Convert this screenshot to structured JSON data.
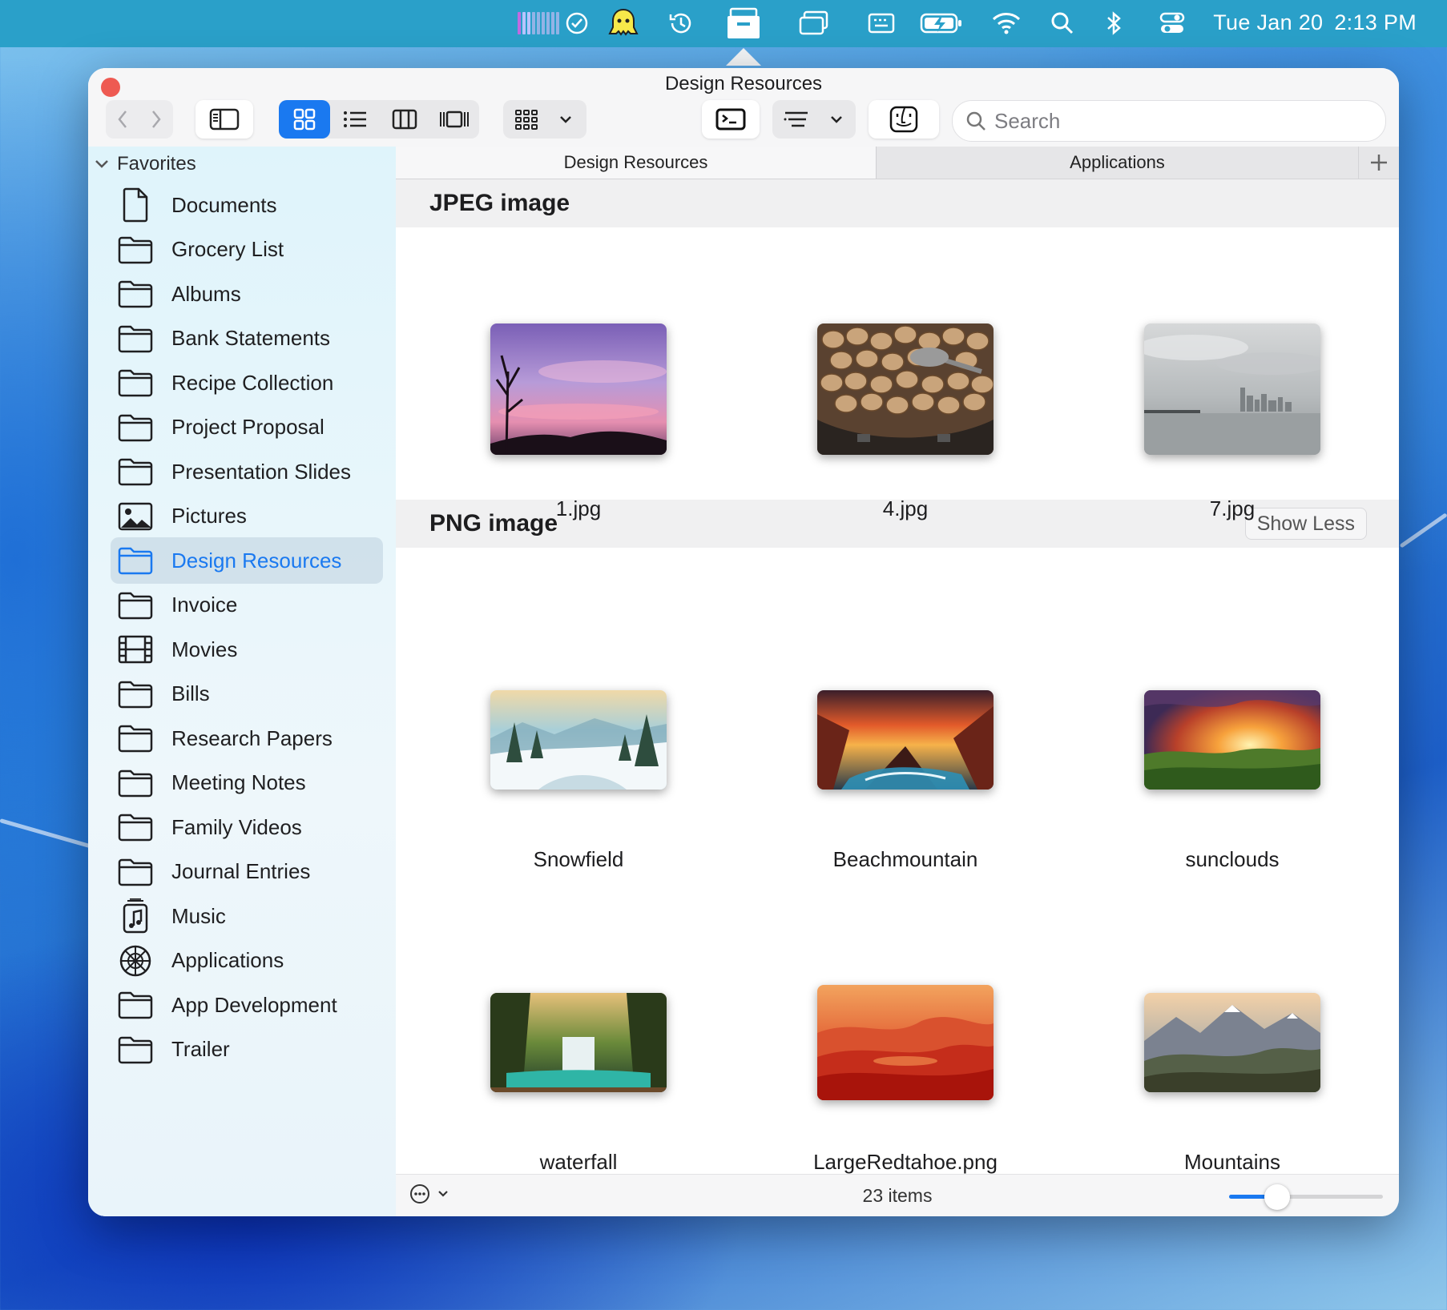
{
  "menubar": {
    "date": "Tue Jan 20",
    "time": "2:13 PM",
    "icons": [
      "activity-bars-icon",
      "check-circle-icon",
      "ghost-app-icon",
      "time-machine-icon",
      "finder-drawer-icon",
      "window-stack-icon",
      "keyboard-icon",
      "battery-charging-icon",
      "wifi-icon",
      "spotlight-search-icon",
      "bluetooth-icon",
      "control-center-icon"
    ]
  },
  "window": {
    "title": "Design Resources",
    "search_placeholder": "Search"
  },
  "tabs": [
    {
      "label": "Design Resources",
      "active": true
    },
    {
      "label": "Applications",
      "active": false
    }
  ],
  "sidebar": {
    "section": "Favorites",
    "items": [
      {
        "label": "Documents",
        "icon": "document-icon"
      },
      {
        "label": "Grocery List",
        "icon": "folder-icon"
      },
      {
        "label": "Albums",
        "icon": "folder-icon"
      },
      {
        "label": "Bank Statements",
        "icon": "folder-icon"
      },
      {
        "label": "Recipe Collection",
        "icon": "folder-icon"
      },
      {
        "label": "Project Proposal",
        "icon": "folder-icon"
      },
      {
        "label": "Presentation Slides",
        "icon": "folder-icon"
      },
      {
        "label": "Pictures",
        "icon": "photo-icon"
      },
      {
        "label": "Design Resources",
        "icon": "folder-icon",
        "selected": true
      },
      {
        "label": "Invoice",
        "icon": "folder-icon"
      },
      {
        "label": "Movies",
        "icon": "film-icon"
      },
      {
        "label": "Bills",
        "icon": "folder-icon"
      },
      {
        "label": "Research Papers",
        "icon": "folder-icon"
      },
      {
        "label": "Meeting Notes",
        "icon": "folder-icon"
      },
      {
        "label": "Family Videos",
        "icon": "folder-icon"
      },
      {
        "label": "Journal Entries",
        "icon": "folder-icon"
      },
      {
        "label": "Music",
        "icon": "music-icon"
      },
      {
        "label": "Applications",
        "icon": "applications-icon"
      },
      {
        "label": "App Development",
        "icon": "folder-icon"
      },
      {
        "label": "Trailer",
        "icon": "folder-icon"
      }
    ]
  },
  "sections": [
    {
      "title": "JPEG image",
      "files": [
        {
          "name": "1.jpg",
          "thumb": "purple-sunset"
        },
        {
          "name": "4.jpg",
          "thumb": "walnuts"
        },
        {
          "name": "7.jpg",
          "thumb": "foggy-city"
        }
      ]
    },
    {
      "title": "PNG image",
      "show_less_label": "Show Less",
      "files": [
        {
          "name": "Snowfield",
          "thumb": "snowfield"
        },
        {
          "name": "Beachmountain",
          "thumb": "beachmountain"
        },
        {
          "name": "sunclouds",
          "thumb": "sunclouds"
        },
        {
          "name": "waterfall",
          "thumb": "waterfall"
        },
        {
          "name": "LargeRedtahoe.png",
          "thumb": "redtahoe"
        },
        {
          "name": "Mountains",
          "thumb": "mountains"
        }
      ]
    }
  ],
  "status": {
    "item_count": "23 items",
    "icon_size_fraction": 0.25
  },
  "colors": {
    "accent": "#1a79f0",
    "menubar": "#2aa0c9",
    "close": "#ee5a52"
  }
}
